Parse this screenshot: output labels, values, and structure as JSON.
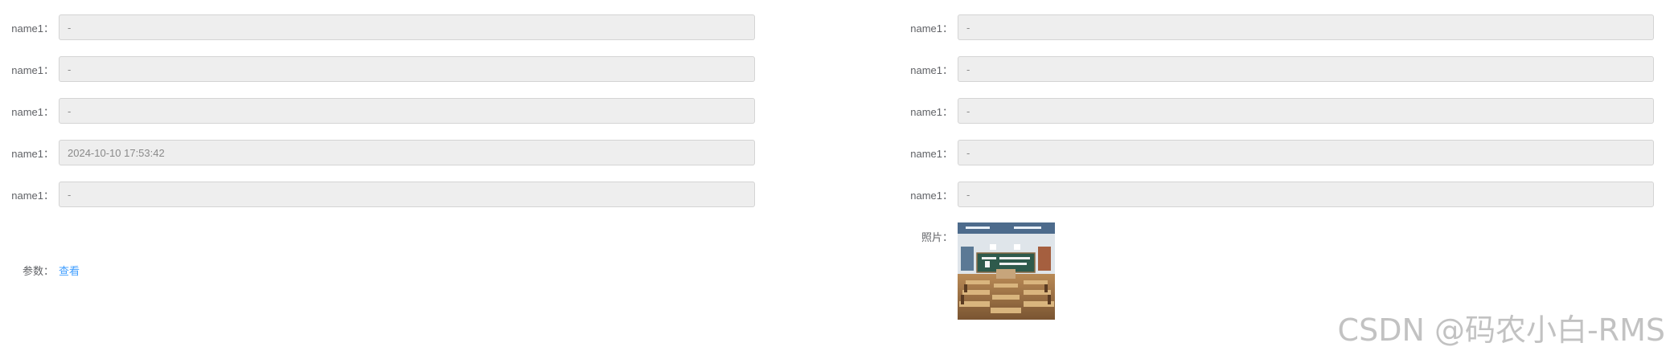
{
  "left": {
    "fields": [
      {
        "label": "name1：",
        "value": "-"
      },
      {
        "label": "name1：",
        "value": "-"
      },
      {
        "label": "name1：",
        "value": "-"
      },
      {
        "label": "name1：",
        "value": "2024-10-10 17:53:42"
      },
      {
        "label": "name1：",
        "value": "-"
      }
    ],
    "param": {
      "label": "参数：",
      "link": "查看"
    }
  },
  "right": {
    "fields": [
      {
        "label": "name1：",
        "value": "-"
      },
      {
        "label": "name1：",
        "value": "-"
      },
      {
        "label": "name1：",
        "value": "-"
      },
      {
        "label": "name1：",
        "value": "-"
      },
      {
        "label": "name1：",
        "value": "-"
      }
    ],
    "photo": {
      "label": "照片："
    }
  },
  "watermark": "CSDN @码农小白-RMS",
  "colors": {
    "link": "#409eff",
    "input_bg": "#eeeeee",
    "input_border": "#d4d4d4"
  }
}
